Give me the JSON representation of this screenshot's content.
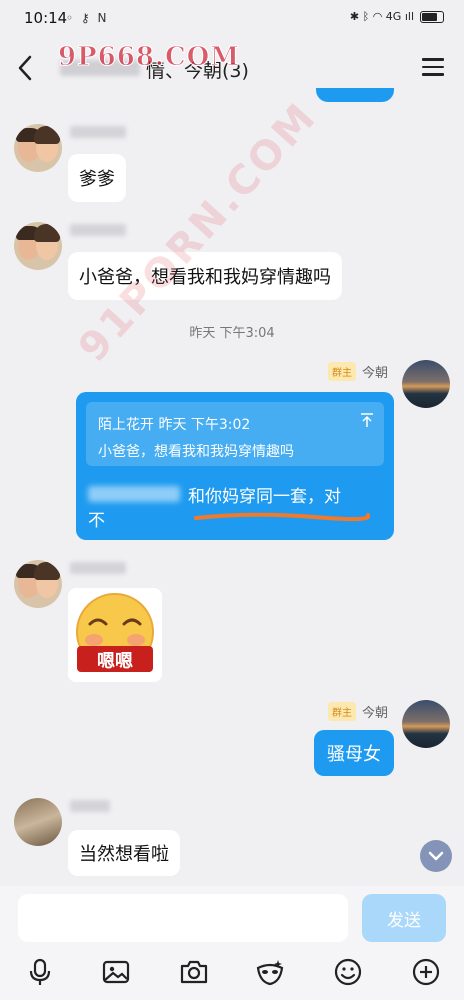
{
  "status_bar": {
    "time": "10:14",
    "left_icons": "◦ ⚷ N",
    "right_icons": "✱ ᛒ ◠ 4G ıll",
    "battery_level": 0.8
  },
  "header": {
    "title": "情、今朝(3)",
    "watermark": "9P668.COM"
  },
  "watermark_diagonal": "91PORN.COM",
  "messages": [
    {
      "side": "left",
      "text": "爹爹"
    },
    {
      "side": "left",
      "text": "小爸爸，想看我和我妈穿情趣吗"
    },
    {
      "side": "left",
      "text": "当然想看啦"
    }
  ],
  "timestamp": "昨天 下午3:04",
  "owner": {
    "badge": "群主",
    "name": "今朝"
  },
  "quoted_reply": {
    "quote_header": "陌上花开 昨天 下午3:02",
    "quote_text": "小爸爸，想看我和我妈穿情趣吗",
    "reply_line1": "和你妈穿同一套，对",
    "reply_line2": "不"
  },
  "sticker": {
    "label": "嗯嗯"
  },
  "self_message": "骚母女",
  "input": {
    "placeholder": "",
    "send_label": "发送"
  },
  "toolbar_icons": [
    "microphone-icon",
    "image-icon",
    "camera-icon",
    "sticker-mask-icon",
    "emoji-icon",
    "plus-icon"
  ],
  "colors": {
    "accent": "#1e9bf0",
    "send_disabled": "#a9d8fb",
    "badge_bg": "#fde8b0",
    "badge_text": "#d48a1a"
  }
}
